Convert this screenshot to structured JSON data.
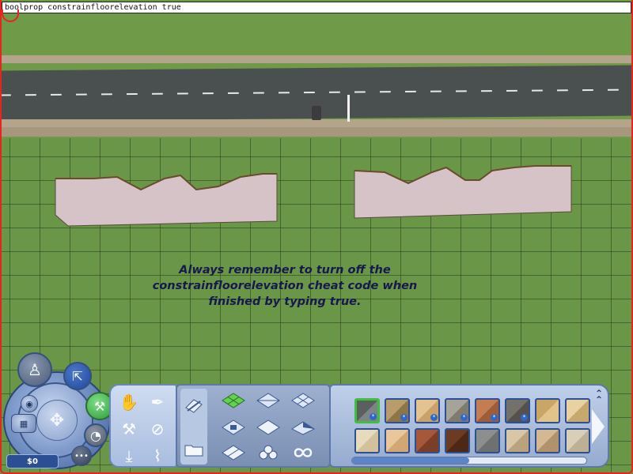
{
  "cheat_console": {
    "value": "boolprop constrainfloorelevation true"
  },
  "tip": {
    "lines": [
      "Always remember to turn off the",
      "constrainfloorelevation cheat code when",
      "finished by typing true."
    ]
  },
  "hud": {
    "funds": "$0",
    "mode_buttons": [
      "live-mode-icon",
      "buy-mode-icon",
      "build-mode-icon",
      "options-icon",
      "camera-icon",
      "floors-icon",
      "more-icon"
    ],
    "build_tools": [
      "hand-icon",
      "eyedropper-icon",
      "sledgehammer-icon",
      "design-tool-icon",
      "blueprint-icon",
      "cancel-icon"
    ],
    "tool_categories": [
      "terrain-tools-icon",
      "floor-tiles-icon",
      "flatten-terrain-icon",
      "raise-terrain-icon",
      "smooth-terrain-icon",
      "floor-grid-icon",
      "level-terrain-icon",
      "lower-terrain-icon",
      "water-icon",
      "paint-terrain-icon",
      "more-floors-icon",
      "folder-icon",
      "infinity-icon"
    ],
    "catalog": {
      "tiles": [
        {
          "color": "#5b5f5e",
          "accent": "#7d8486",
          "badge": "*",
          "selected": true
        },
        {
          "color": "#b89c6a",
          "accent": "#8e7547",
          "badge": "*"
        },
        {
          "color": "#e3c38f",
          "accent": "#caa269",
          "badge": "*"
        },
        {
          "color": "#a6a39a",
          "accent": "#7f7b6f",
          "badge": "*"
        },
        {
          "color": "#c47d52",
          "accent": "#9e5c39",
          "badge": "*"
        },
        {
          "color": "#74706a",
          "accent": "#55514d",
          "badge": "*"
        },
        {
          "color": "#c9a666",
          "accent": "#e2c48b",
          "badge": ""
        },
        {
          "color": "#e8d2a2",
          "accent": "#c7a96e",
          "badge": ""
        },
        {
          "color": "#e7dbbd",
          "accent": "#d2c29b",
          "badge": ""
        },
        {
          "color": "#e9c79a",
          "accent": "#d2a773",
          "badge": ""
        },
        {
          "color": "#a8583a",
          "accent": "#7b3e28",
          "badge": ""
        },
        {
          "color": "#6b3b22",
          "accent": "#4d2814",
          "badge": ""
        },
        {
          "color": "#8c8f8e",
          "accent": "#6e7170",
          "badge": ""
        },
        {
          "color": "#d8c6a6",
          "accent": "#b8a37c",
          "badge": ""
        },
        {
          "color": "#d4b892",
          "accent": "#b0936b",
          "badge": ""
        },
        {
          "color": "#d9ceb8",
          "accent": "#bdb095",
          "badge": ""
        }
      ],
      "scroll_fraction": 0.5
    }
  }
}
